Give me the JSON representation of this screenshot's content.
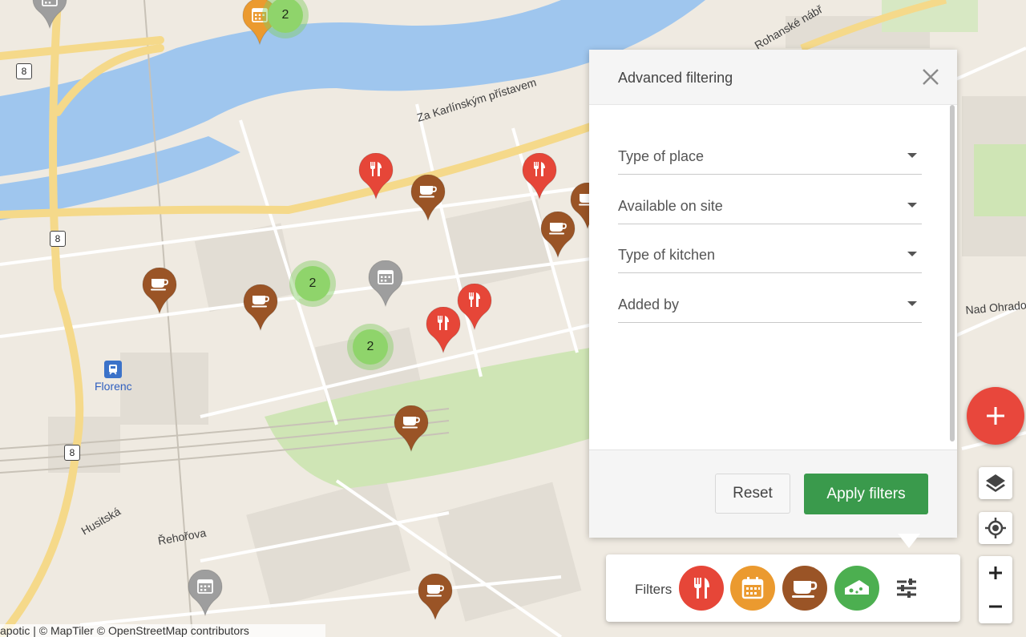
{
  "map": {
    "street_labels": [
      "Za Karlínským přístavem",
      "Rohanské nábř",
      "Nad Ohradou",
      "Husitská",
      "Řehořova"
    ],
    "road_badge": "8",
    "station_label": "Florenc",
    "attribution": "apotic | © MapTiler © OpenStreetMap contributors",
    "cluster_counts": [
      "2",
      "2",
      "2"
    ],
    "colors": {
      "water": "#9fc6ee",
      "road_major": "#f5d98a",
      "park": "#cfe5b5",
      "restaurant_pin": "#e64638",
      "cafe_pin": "#9a5426",
      "event_pin_gray": "#9e9e9e",
      "event_pin_orange": "#eb9a2f"
    },
    "pin_icons": {
      "restaurant": "fork-knife-icon",
      "cafe": "coffee-cup-icon",
      "event": "calendar-icon"
    }
  },
  "panel": {
    "title": "Advanced filtering",
    "fields": [
      {
        "placeholder": "Type of place"
      },
      {
        "placeholder": "Available on site"
      },
      {
        "placeholder": "Type of kitchen"
      },
      {
        "placeholder": "Added by"
      }
    ],
    "reset_label": "Reset",
    "apply_label": "Apply filters",
    "apply_color": "#3a9a4c"
  },
  "filters_bar": {
    "label": "Filters",
    "buttons": [
      {
        "icon": "fork-knife-icon",
        "color": "#e64638"
      },
      {
        "icon": "calendar-icon",
        "color": "#eb9a2f"
      },
      {
        "icon": "coffee-cup-icon",
        "color": "#9a5426"
      },
      {
        "icon": "cheese-icon",
        "color": "#4caf50"
      }
    ],
    "tune_icon": "tune-icon"
  },
  "controls": {
    "add_color": "#e8473c",
    "icons": [
      "plus-icon",
      "layers-icon",
      "my-location-icon",
      "zoom-in-icon",
      "zoom-out-icon"
    ]
  }
}
